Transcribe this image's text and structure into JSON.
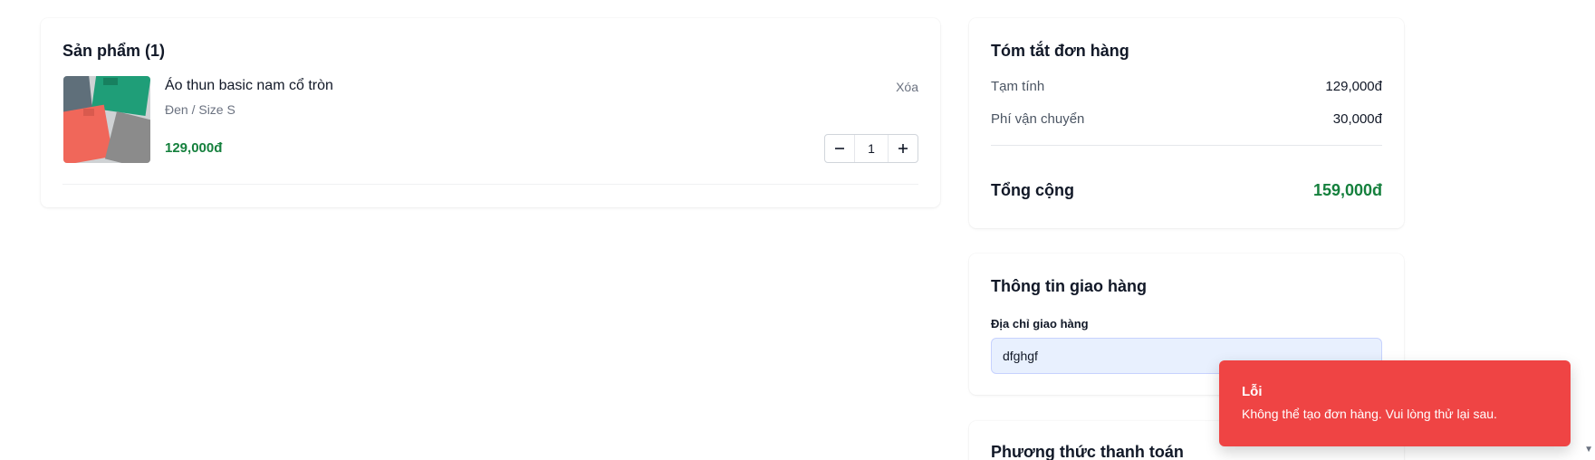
{
  "products": {
    "title": "Sản phẩm (1)",
    "items": [
      {
        "name": "Áo thun basic nam cổ tròn",
        "variant": "Đen / Size S",
        "price": "129,000đ",
        "remove_label": "Xóa",
        "quantity": "1",
        "thumbnail_icon": "folded-shirts-image"
      }
    ]
  },
  "summary": {
    "title": "Tóm tắt đơn hàng",
    "subtotal_label": "Tạm tính",
    "subtotal_value": "129,000đ",
    "shipping_label": "Phí vận chuyển",
    "shipping_value": "30,000đ",
    "total_label": "Tổng cộng",
    "total_value": "159,000đ"
  },
  "shipping": {
    "title": "Thông tin giao hàng",
    "address_label": "Địa chỉ giao hàng",
    "address_value": "dfghgf"
  },
  "payment": {
    "title": "Phương thức thanh toán"
  },
  "toast": {
    "title": "Lỗi",
    "message": "Không thể tạo đơn hàng. Vui lòng thử lại sau."
  },
  "colors": {
    "price_green": "#15803d",
    "toast_red": "#ef4444",
    "input_bg": "#e8f0fe"
  }
}
